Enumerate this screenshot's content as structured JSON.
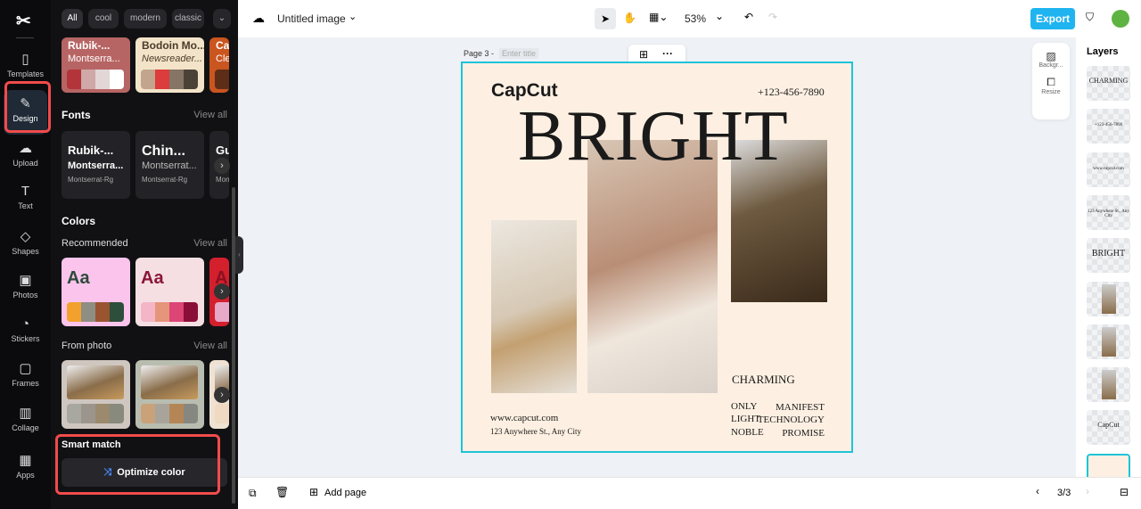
{
  "nav": {
    "items": [
      {
        "label": "Templates",
        "icon": "template-icon"
      },
      {
        "label": "Design",
        "icon": "design-icon"
      },
      {
        "label": "Upload",
        "icon": "upload-icon"
      },
      {
        "label": "Text",
        "icon": "text-icon"
      },
      {
        "label": "Shapes",
        "icon": "shapes-icon"
      },
      {
        "label": "Photos",
        "icon": "photos-icon"
      },
      {
        "label": "Stickers",
        "icon": "stickers-icon"
      },
      {
        "label": "Frames",
        "icon": "frames-icon"
      },
      {
        "label": "Collage",
        "icon": "collage-icon"
      },
      {
        "label": "Apps",
        "icon": "apps-icon"
      }
    ]
  },
  "panel": {
    "filters": [
      "All",
      "cool",
      "modern",
      "classic"
    ],
    "styles": [
      {
        "title": "Rubik-...",
        "sub": "Montserra...",
        "bg": "#b76564",
        "swatches": [
          "#b3343a",
          "#cfa8a8",
          "#e3d6d6",
          "#ffffff"
        ]
      },
      {
        "title": "Bodoin Mo...",
        "sub": "Newsreader...",
        "bg": "#f3e4c9",
        "swatches": [
          "#c3a58d",
          "#dc3c3c",
          "#867565",
          "#4b4237"
        ]
      },
      {
        "title": "Ca",
        "sub": "Cle",
        "bg": "#c9551f",
        "swatches": [
          "#5e2d17"
        ]
      }
    ],
    "fonts_title": "Fonts",
    "view_all": "View all",
    "fonts": [
      {
        "title": "Rubik-...",
        "sub": "Montserra...",
        "small": "Montserrat-Rg"
      },
      {
        "title": "Chin...",
        "sub": "Montserrat...",
        "small": "Montserrat-Rg"
      },
      {
        "title": "Gu",
        "sub": "",
        "small": "Mon"
      }
    ],
    "colors_title": "Colors",
    "recommended": "Recommended",
    "rec": [
      {
        "aa": "Aa",
        "bg": "#fbc4ec",
        "fg": "#2e4a3b",
        "swatches": [
          "#f2a22c",
          "#8e8e82",
          "#9a5430",
          "#2d4e3b"
        ]
      },
      {
        "aa": "Aa",
        "bg": "#f5dfe3",
        "fg": "#8a1638",
        "swatches": [
          "#f4b6c6",
          "#e5957a",
          "#dc4576",
          "#8a0f38"
        ]
      },
      {
        "aa": "A",
        "bg": "#d41f2d",
        "fg": "#8a1020",
        "swatches": [
          "#e8a8c8"
        ]
      }
    ],
    "from_photo": "From photo",
    "photo": [
      {
        "bg": "#cfc6c0",
        "swatches": [
          "#a9a8a0",
          "#9c958e",
          "#9b8a6e",
          "#878a7c"
        ]
      },
      {
        "bg": "#b9bdb0",
        "swatches": [
          "#c9a27a",
          "#a8a49b",
          "#b58655",
          "#878781"
        ]
      },
      {
        "bg": "#efe2d2",
        "swatches": [
          "#efd9c2"
        ]
      }
    ],
    "smart_match": "Smart match",
    "optimize": "Optimize color"
  },
  "top": {
    "title": "Untitled image",
    "zoom": "53%",
    "export": "Export"
  },
  "page": {
    "label": "Page 3 -",
    "title_placeholder": "Enter title",
    "logo": "CapCut",
    "phone": "+123-456-7890",
    "headline": "BRIGHT",
    "charming": "CHARMING",
    "left_words": [
      "ONLY",
      "LIGHT",
      "NOBLE"
    ],
    "right_words": [
      "MANIFEST",
      "TECHNOLOGY",
      "PROMISE"
    ],
    "website": "www.capcut.com",
    "address": "123 Anywhere St., Any City"
  },
  "side_tools": {
    "background": "Backgr...",
    "resize": "Resize"
  },
  "layers": {
    "title": "Layers",
    "items": [
      "CHARMING",
      "+123-456-7890",
      "www.capcut.com",
      "123 Anywhere St., Any City",
      "BRIGHT",
      "",
      "",
      "",
      "CapCut",
      ""
    ]
  },
  "bottom": {
    "add_page": "Add page",
    "pager": "3/3"
  }
}
